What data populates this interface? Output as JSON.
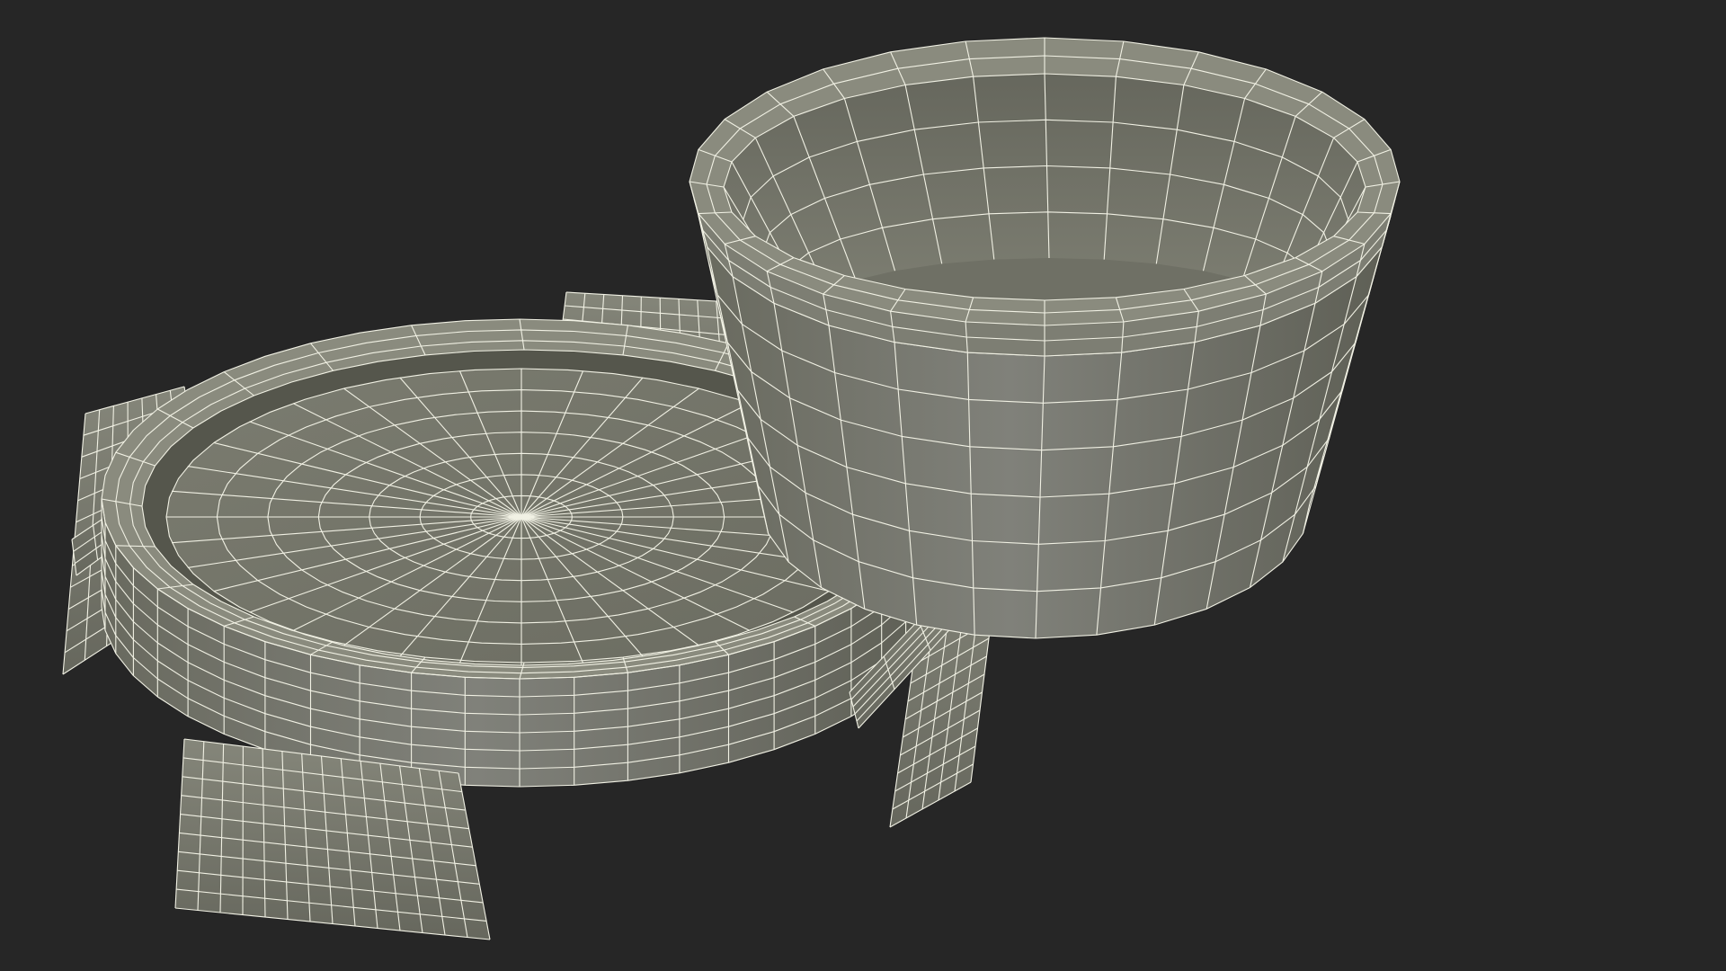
{
  "viewport": {
    "background": "#262626"
  },
  "render_style": "wireframe-on-shaded",
  "colors": {
    "surface": "#75766a",
    "surface_dark": "#55564c",
    "surface_light": "#8a8b7e",
    "wire": "#f1f1e4"
  },
  "objects": [
    {
      "name": "tray-with-clips",
      "clips": 4,
      "radial_segments": 48,
      "rings": 7
    },
    {
      "name": "open-container",
      "segments": 28,
      "rows": 6
    }
  ]
}
